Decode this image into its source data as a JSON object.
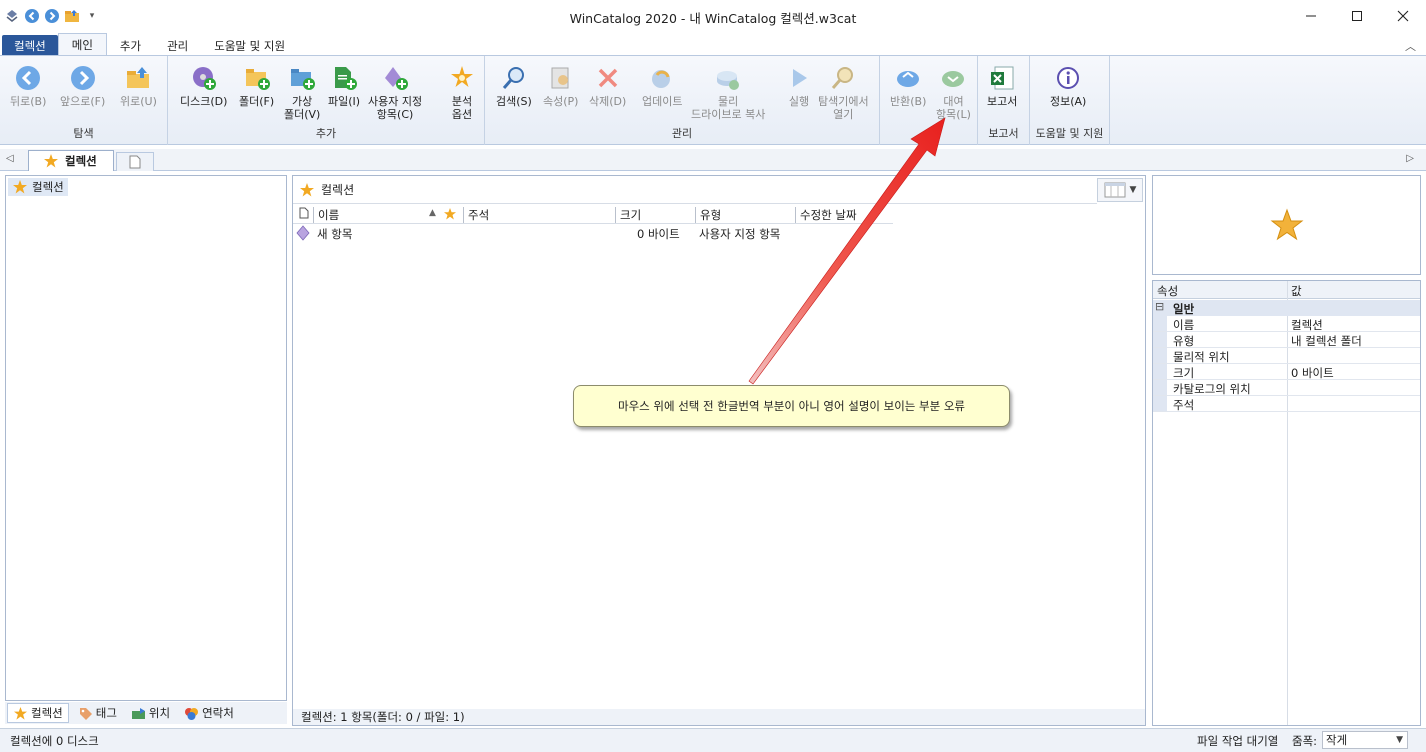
{
  "window": {
    "title": "WinCatalog 2020 - 내 WinCatalog 컬렉션.w3cat",
    "minimize": "—",
    "maximize": "☐",
    "close": "✕"
  },
  "ribbon_tabs": [
    {
      "label": "컬렉션"
    },
    {
      "label": "메인"
    },
    {
      "label": "추가"
    },
    {
      "label": "관리"
    },
    {
      "label": "도움말 및 지원"
    }
  ],
  "ribbon_groups": {
    "navigate": {
      "label": "탐색",
      "buttons": [
        {
          "label": "뒤로(B)"
        },
        {
          "label": "앞으로(F)"
        },
        {
          "label": "위로(U)"
        }
      ]
    },
    "add": {
      "label": "추가",
      "buttons": [
        {
          "label": "디스크(D)"
        },
        {
          "label": "폴더(F)"
        },
        {
          "label": "가상",
          "label2": "폴더(V)"
        },
        {
          "label": "파일(I)"
        },
        {
          "label": "사용자 지정",
          "label2": "항목(C)"
        },
        {
          "label": "분석",
          "label2": "옵션"
        }
      ]
    },
    "manage": {
      "label": "관리",
      "buttons": [
        {
          "label": "검색(S)"
        },
        {
          "label": "속성(P)"
        },
        {
          "label": "삭제(D)"
        },
        {
          "label": "업데이트"
        },
        {
          "label": "물리",
          "label2": "드라이브로 복사"
        },
        {
          "label": "실행"
        },
        {
          "label": "탐색기에서",
          "label2": "열기"
        }
      ]
    },
    "loan": {
      "buttons": [
        {
          "label": "반환(B)"
        },
        {
          "label": "대여",
          "label2": "항목(L)"
        }
      ]
    },
    "report": {
      "label": "보고서",
      "buttons": [
        {
          "label": "보고서"
        }
      ]
    },
    "help": {
      "label": "도움말 및 지원",
      "buttons": [
        {
          "label": "정보(A)"
        }
      ]
    }
  },
  "doc_tab": {
    "label": "컬렉션"
  },
  "tree": {
    "root": "컬렉션"
  },
  "left_tabs": [
    {
      "label": "컬렉션"
    },
    {
      "label": "태그"
    },
    {
      "label": "위치"
    },
    {
      "label": "연락처"
    }
  ],
  "center": {
    "path": "컬렉션",
    "columns": [
      "이름",
      "주석",
      "크기",
      "유형",
      "수정한 날짜"
    ],
    "rows": [
      {
        "name": "새 항목",
        "comment": "",
        "size": "0 바이트",
        "type": "사용자 지정 항목",
        "modified": ""
      }
    ],
    "status": "컬렉션: 1 항목(폴더: 0 / 파일: 1)"
  },
  "properties": {
    "col_property": "속성",
    "col_value": "값",
    "category": "일반",
    "category_toggle": "⊟",
    "rows": [
      {
        "key": "이름",
        "value": "컬렉션"
      },
      {
        "key": "유형",
        "value": "내 컬렉션 폴더"
      },
      {
        "key": "물리적 위치",
        "value": ""
      },
      {
        "key": "크기",
        "value": "0 바이트"
      },
      {
        "key": "카탈로그의 위치",
        "value": ""
      },
      {
        "key": "주석",
        "value": ""
      }
    ]
  },
  "statusbar": {
    "left": "컬렉션에 0 디스크",
    "queue": "파일 작업 대기열",
    "zoom_label": "줌폭:",
    "zoom_value": "작게"
  },
  "annotation": {
    "text": "마우스 위에 선택 전 한글번역 부분이 아니 영어 설명이 보이는 부분 오류"
  },
  "colors": {
    "accent": "#2b579a",
    "ribbon_bg": "#eaf0f8",
    "callout_bg": "#ffffd0",
    "arrow": "#e8201e"
  }
}
